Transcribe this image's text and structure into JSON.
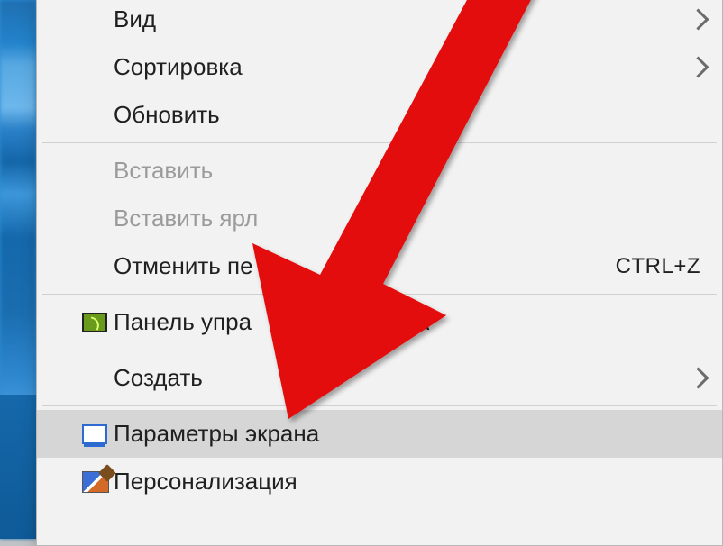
{
  "menu": {
    "item_view": "Вид",
    "item_sort": "Сортировка",
    "item_refresh": "Обновить",
    "item_paste": "Вставить",
    "item_paste_short": "Вставить ярл",
    "item_undo": "Отменить пе",
    "undo_shortcut": "CTRL+Z",
    "item_nvidia": "Панель упра",
    "item_nvidia_tail": "А",
    "item_new": "Создать",
    "item_display": "Параметры экрана",
    "item_personalize": "Персонализация"
  }
}
